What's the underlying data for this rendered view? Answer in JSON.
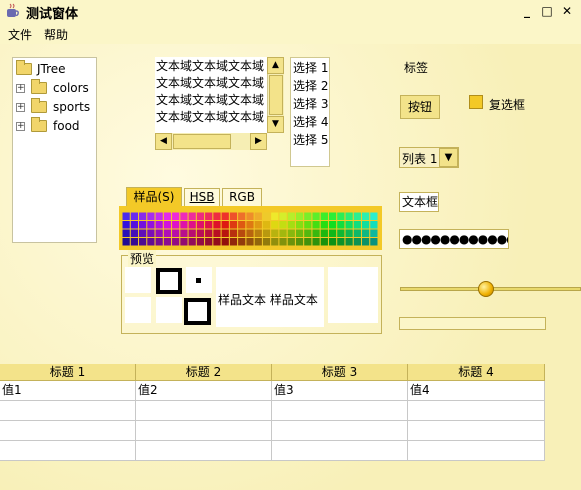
{
  "window": {
    "title": "测试窗体",
    "buttons": {
      "minimize": "_",
      "maximize": "□",
      "close": "✕"
    }
  },
  "menubar": {
    "items": [
      "文件",
      "帮助"
    ]
  },
  "tree": {
    "root": "JTree",
    "children": [
      "colors",
      "sports",
      "food"
    ]
  },
  "textarea": {
    "lines": [
      "文本域文本域文本域",
      "文本域文本域文本域",
      "文本域文本域文本域",
      "文本域文本域文本域"
    ]
  },
  "list": {
    "items": [
      "选择 1",
      "选择 2",
      "选择 3",
      "选择 4",
      "选择 5"
    ]
  },
  "label": {
    "text": "标签"
  },
  "button": {
    "text": "按钮"
  },
  "checkbox": {
    "label": "复选框",
    "checked": false
  },
  "combo": {
    "selected": "列表 1"
  },
  "textfield": {
    "value": "文本框"
  },
  "password": {
    "value": "●●●●●●●●●●●●●●●●"
  },
  "slider": {
    "value": 0.47
  },
  "progress": {
    "value": 0
  },
  "color_chooser": {
    "tabs": [
      "样品(S)",
      "HSB",
      "RGB"
    ],
    "preview_title": "预览",
    "sample_text": "样品文本  样品文本",
    "sample_text_faded": "样品文本  样品文本"
  },
  "table": {
    "headers": [
      "标题 1",
      "标题 2",
      "标题 3",
      "标题 4"
    ],
    "rows": [
      [
        "值1",
        "值2",
        "值3",
        "值4"
      ],
      [
        "",
        "",
        "",
        ""
      ],
      [
        "",
        "",
        "",
        ""
      ],
      [
        "",
        "",
        "",
        ""
      ]
    ]
  },
  "colors": {
    "accent": "#f3c927",
    "background": "#fbf6c8",
    "border": "#c4b25a"
  }
}
